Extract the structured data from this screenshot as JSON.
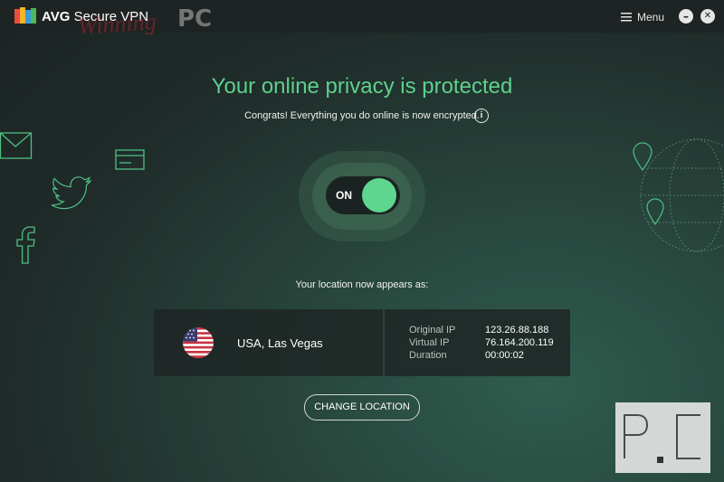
{
  "window": {
    "brand": "AVG",
    "product": "Secure VPN",
    "watermark_script": "Winning",
    "watermark_pc": "PC",
    "menu_label": "Menu",
    "minimize_glyph": "–",
    "close_glyph": "✕"
  },
  "status": {
    "headline": "Your online privacy is protected",
    "subline": "Congrats! Everything you do online is now encrypted.",
    "info_glyph": "i"
  },
  "toggle": {
    "label": "ON",
    "state": "on"
  },
  "location": {
    "caption": "Your location now appears as:",
    "country": "USA, Las Vegas",
    "flag": "us-flag-icon",
    "original_ip_label": "Original IP",
    "original_ip": "123.26.88.188",
    "virtual_ip_label": "Virtual IP",
    "virtual_ip": "76.164.200.119",
    "duration_label": "Duration",
    "duration": "00:00:02"
  },
  "actions": {
    "change_location": "CHANGE LOCATION"
  },
  "overlay": {
    "pc_mark_left": "P",
    "pc_mark_right": "C"
  },
  "colors": {
    "accent_green": "#5fd08c",
    "background": "#1f2b29",
    "titlebar": "#1e2323"
  }
}
